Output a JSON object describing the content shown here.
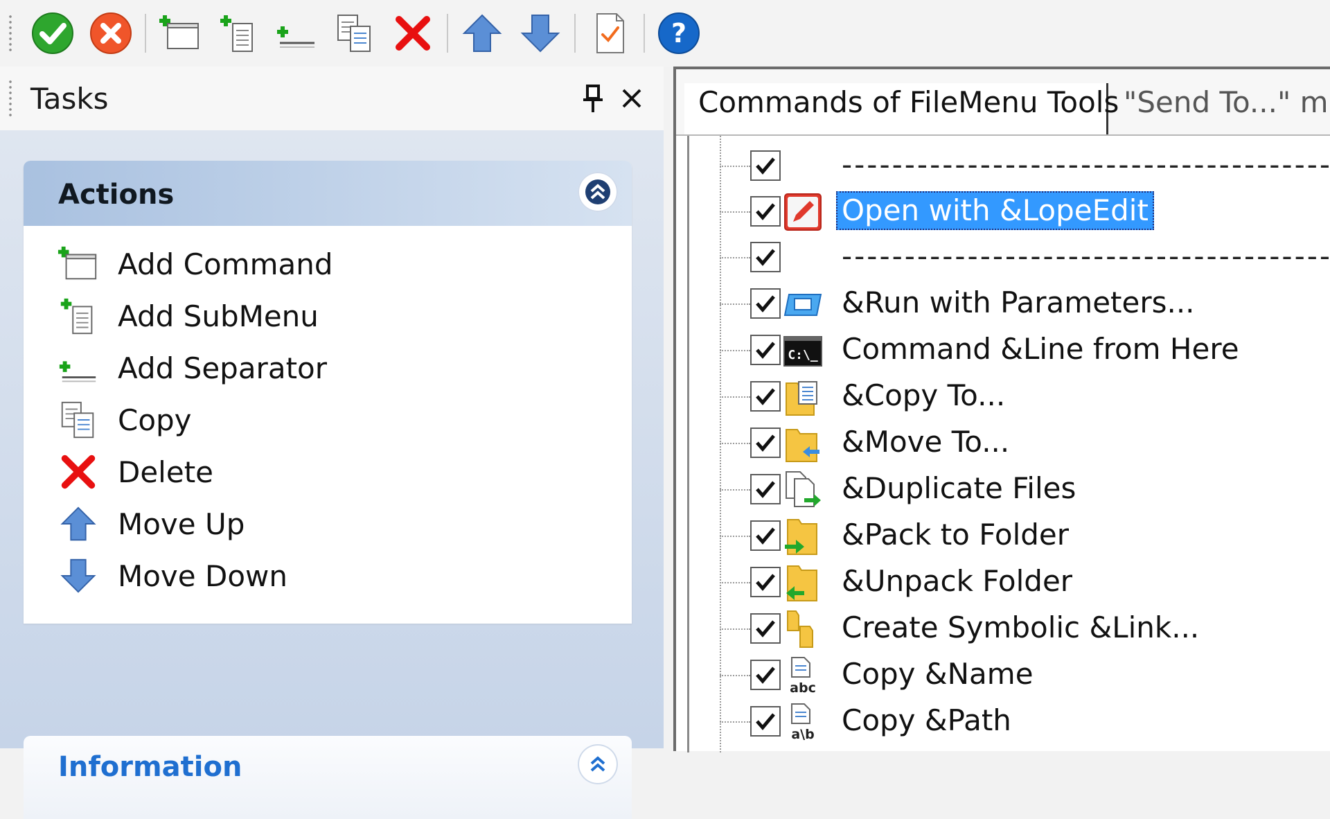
{
  "toolbar": {
    "buttons": [
      {
        "name": "ok-button",
        "icon": "green-check-icon"
      },
      {
        "name": "cancel-button",
        "icon": "red-x-circle-icon"
      },
      {
        "name": "add-command-button",
        "icon": "add-command-icon"
      },
      {
        "name": "add-submenu-button",
        "icon": "add-submenu-icon"
      },
      {
        "name": "add-separator-button",
        "icon": "add-separator-icon"
      },
      {
        "name": "copy-button",
        "icon": "copy-icon"
      },
      {
        "name": "delete-button",
        "icon": "delete-icon"
      },
      {
        "name": "move-up-button",
        "icon": "arrow-up-icon"
      },
      {
        "name": "move-down-button",
        "icon": "arrow-down-icon"
      },
      {
        "name": "checklist-button",
        "icon": "checklist-icon"
      },
      {
        "name": "help-button",
        "icon": "help-icon"
      }
    ]
  },
  "tasks": {
    "title": "Tasks",
    "actions": {
      "title": "Actions",
      "items": [
        {
          "label": "Add Command",
          "icon": "add-command-icon"
        },
        {
          "label": "Add SubMenu",
          "icon": "add-submenu-icon"
        },
        {
          "label": "Add Separator",
          "icon": "add-separator-icon"
        },
        {
          "label": "Copy",
          "icon": "copy-icon"
        },
        {
          "label": "Delete",
          "icon": "delete-icon"
        },
        {
          "label": "Move Up",
          "icon": "arrow-up-icon"
        },
        {
          "label": "Move Down",
          "icon": "arrow-down-icon"
        }
      ]
    },
    "information": {
      "title": "Information"
    }
  },
  "commands": {
    "tabs": [
      {
        "label": "Commands of FileMenu Tools",
        "active": true
      },
      {
        "label": "\"Send To...\" m",
        "active": false
      }
    ],
    "items": [
      {
        "label": "-------------------------------------------",
        "checked": true,
        "icon": "",
        "separator": true
      },
      {
        "label": "Open with &LopeEdit",
        "checked": true,
        "icon": "lopeedit-pencil-icon",
        "selected": true
      },
      {
        "label": "-------------------------------------------",
        "checked": true,
        "icon": "",
        "separator": true
      },
      {
        "label": "&Run with Parameters...",
        "checked": true,
        "icon": "run-window-icon"
      },
      {
        "label": "Command &Line from Here",
        "checked": true,
        "icon": "console-icon"
      },
      {
        "label": "&Copy To...",
        "checked": true,
        "icon": "copy-to-folder-icon"
      },
      {
        "label": "&Move To...",
        "checked": true,
        "icon": "move-to-folder-icon"
      },
      {
        "label": "&Duplicate Files",
        "checked": true,
        "icon": "duplicate-files-icon"
      },
      {
        "label": "&Pack to Folder",
        "checked": true,
        "icon": "pack-folder-icon"
      },
      {
        "label": "&Unpack Folder",
        "checked": true,
        "icon": "unpack-folder-icon"
      },
      {
        "label": "Create Symbolic &Link...",
        "checked": true,
        "icon": "symbolic-link-icon"
      },
      {
        "label": "Copy &Name",
        "checked": true,
        "icon": "copy-name-icon"
      },
      {
        "label": "Copy &Path",
        "checked": true,
        "icon": "copy-path-icon"
      }
    ]
  },
  "colors": {
    "selection": "#3399ff",
    "info_title": "#1f6fd0",
    "actions_header": "#a9c1e0"
  }
}
